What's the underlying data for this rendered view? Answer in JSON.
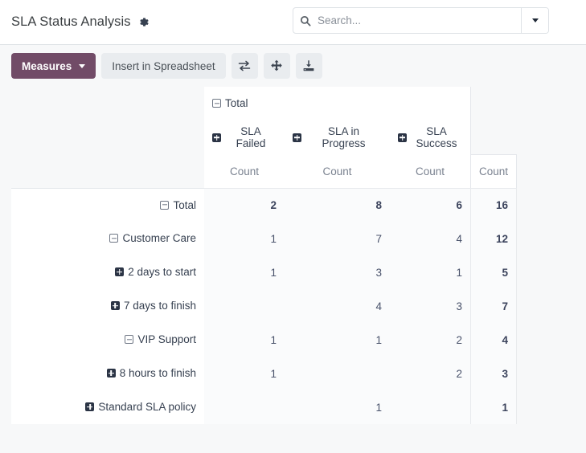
{
  "breadcrumb": {
    "title": "SLA Status Analysis",
    "settings_icon": "gear-icon"
  },
  "search": {
    "placeholder": "Search...",
    "value": "",
    "icon": "search-icon",
    "toggle_icon": "chevron-down-icon"
  },
  "toolbar": {
    "measures_label": "Measures",
    "insert_label": "Insert in Spreadsheet",
    "flip_axis_title": "flip-axis-icon",
    "expand_all_title": "expand-all-icon",
    "download_title": "download-xlsx-icon"
  },
  "colors": {
    "brand": "#714b67",
    "toolbar_bg": "#f7f8f9",
    "cell_bg": "#fafbfc",
    "border": "#e4e7eb"
  },
  "pivot": {
    "col_root": {
      "label": "Total",
      "state": "collapsed-icon"
    },
    "col_groups": [
      {
        "label": "SLA Failed",
        "state": "expand-icon"
      },
      {
        "label": "SLA in Progress",
        "state": "expand-icon"
      },
      {
        "label": "SLA Success",
        "state": "expand-icon"
      }
    ],
    "measure_label": "Count",
    "measures_row": [
      "Count",
      "Count",
      "Count",
      "Count"
    ],
    "rows": [
      {
        "label": "Total",
        "indent": 0,
        "state": "collapsed-icon",
        "is_total": true,
        "values": [
          "2",
          "8",
          "6"
        ],
        "total": "16"
      },
      {
        "label": "Customer Care",
        "indent": 1,
        "state": "collapsed-icon",
        "is_total": false,
        "values": [
          "1",
          "7",
          "4"
        ],
        "total": "12"
      },
      {
        "label": "2 days to start",
        "indent": 2,
        "state": "expand-icon",
        "is_total": false,
        "values": [
          "1",
          "3",
          "1"
        ],
        "total": "5"
      },
      {
        "label": "7 days to finish",
        "indent": 2,
        "state": "expand-icon",
        "is_total": false,
        "values": [
          "",
          "4",
          "3"
        ],
        "total": "7"
      },
      {
        "label": "VIP Support",
        "indent": 1,
        "state": "collapsed-icon",
        "is_total": false,
        "values": [
          "1",
          "1",
          "2"
        ],
        "total": "4"
      },
      {
        "label": "8 hours to finish",
        "indent": 2,
        "state": "expand-icon",
        "is_total": false,
        "values": [
          "1",
          "",
          "2"
        ],
        "total": "3"
      },
      {
        "label": "Standard SLA policy",
        "indent": 2,
        "state": "expand-icon",
        "is_total": false,
        "values": [
          "",
          "1",
          ""
        ],
        "total": "1"
      }
    ]
  }
}
